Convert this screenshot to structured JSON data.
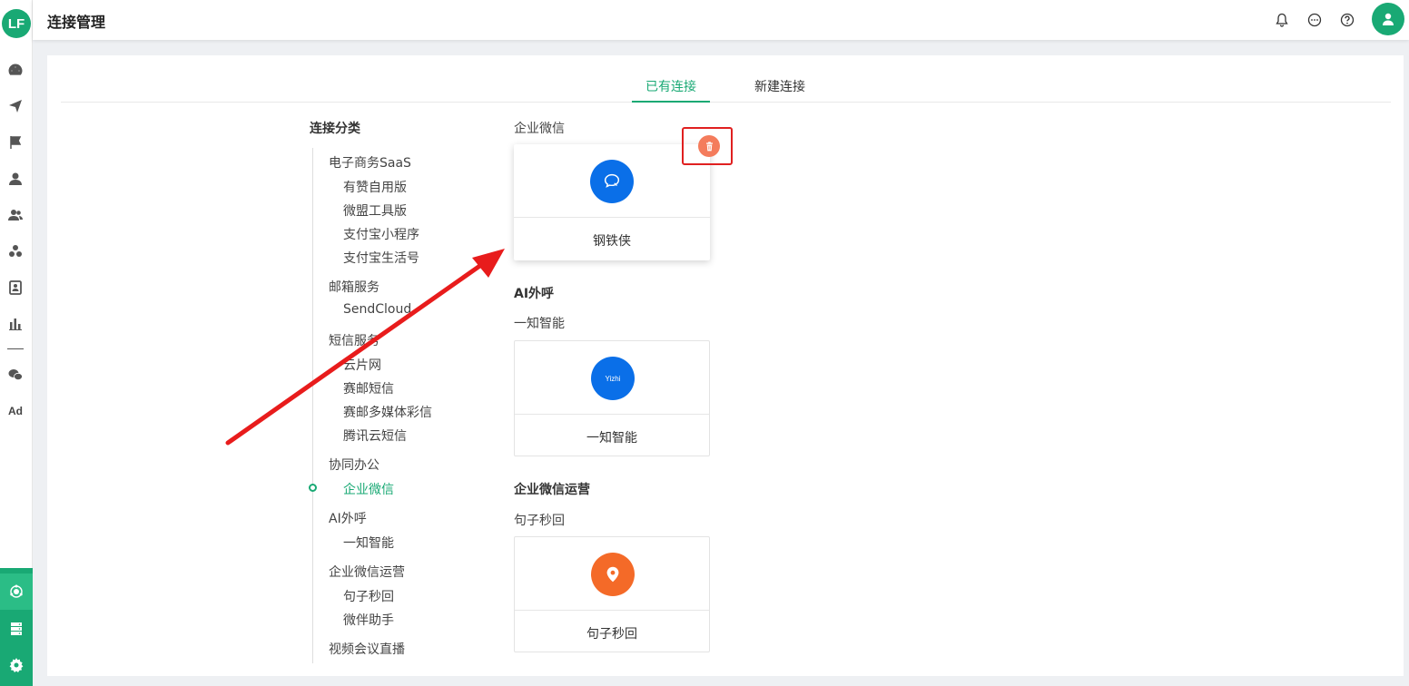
{
  "app": {
    "logo_text": "LF",
    "page_title": "连接管理"
  },
  "sidebar": {
    "icons": [
      "dashboard-icon",
      "send-icon",
      "flag-icon",
      "user-icon",
      "users-icon",
      "group-icon",
      "badge-icon",
      "chart-icon",
      "wechat-icon"
    ],
    "ad_label": "Ad",
    "bottom_icons": [
      "connect-icon",
      "server-icon",
      "gear-icon"
    ]
  },
  "tabs": [
    {
      "label": "已有连接",
      "active": true
    },
    {
      "label": "新建连接",
      "active": false
    }
  ],
  "categories": {
    "title": "连接分类",
    "groups": [
      {
        "label": "电子商务SaaS",
        "items": [
          "有赞自用版",
          "微盟工具版",
          "支付宝小程序",
          "支付宝生活号"
        ]
      },
      {
        "label": "邮箱服务",
        "items": [
          "SendCloud"
        ]
      },
      {
        "label": "短信服务",
        "items": [
          "云片网",
          "赛邮短信",
          "赛邮多媒体彩信",
          "腾讯云短信"
        ]
      },
      {
        "label": "协同办公",
        "items": [
          "企业微信"
        ]
      },
      {
        "label": "AI外呼",
        "items": [
          "一知智能"
        ]
      },
      {
        "label": "企业微信运营",
        "items": [
          "句子秒回",
          "微伴助手"
        ]
      },
      {
        "label": "视频会议直播",
        "items": []
      }
    ],
    "active_item": "企业微信"
  },
  "sections": [
    {
      "title": "",
      "subtitle": "企业微信",
      "card": {
        "label": "钢铁侠",
        "logo_color": "#0a6fe8",
        "icon": "chat-bubble-icon"
      }
    },
    {
      "title": "AI外呼",
      "subtitle": "一知智能",
      "card": {
        "label": "一知智能",
        "logo_color": "#0a6fe8",
        "logo_text": "Yizhi",
        "icon": "yizhi-logo-icon"
      }
    },
    {
      "title": "企业微信运营",
      "subtitle": "句子秒回",
      "card": {
        "label": "句子秒回",
        "logo_color": "#f46a28",
        "icon": "location-pin-icon"
      }
    }
  ],
  "colors": {
    "accent": "#19a974",
    "delete": "#f47c5c",
    "annotation": "#e02020"
  }
}
